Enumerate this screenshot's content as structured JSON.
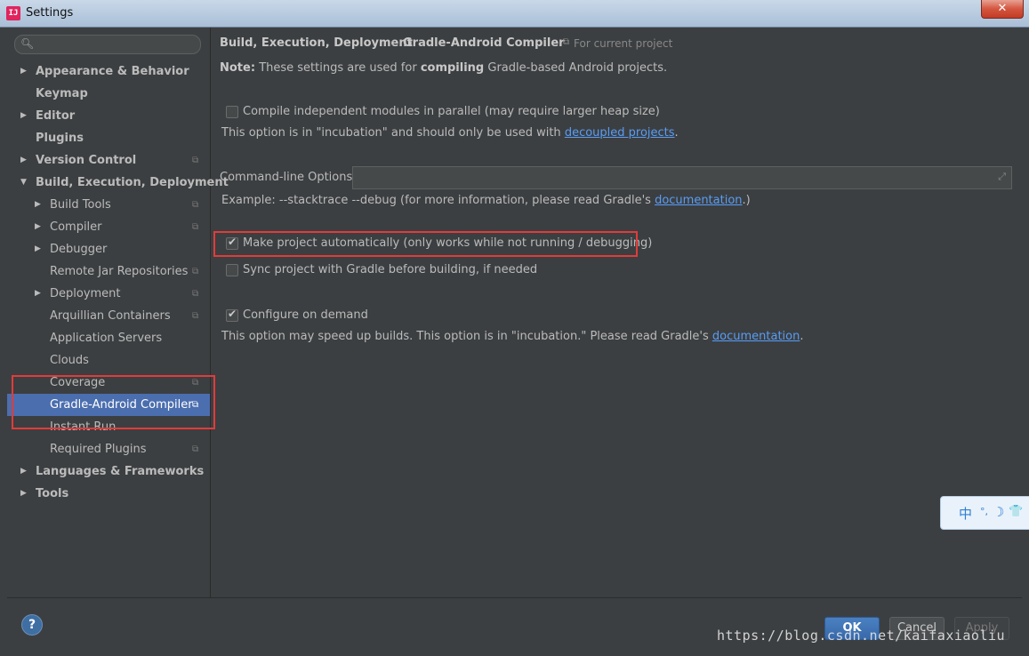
{
  "window": {
    "title": "Settings",
    "app_icon_text": "IJ",
    "close_glyph": "✕"
  },
  "sidebar": {
    "search_placeholder": "",
    "items": [
      {
        "label": "Appearance & Behavior",
        "arrow": "▶",
        "bold": true,
        "level": 0
      },
      {
        "label": "Keymap",
        "arrow": "",
        "bold": true,
        "level": 0
      },
      {
        "label": "Editor",
        "arrow": "▶",
        "bold": true,
        "level": 0
      },
      {
        "label": "Plugins",
        "arrow": "",
        "bold": true,
        "level": 0
      },
      {
        "label": "Version Control",
        "arrow": "▶",
        "bold": true,
        "level": 0,
        "project": true
      },
      {
        "label": "Build, Execution, Deployment",
        "arrow": "▼",
        "bold": true,
        "level": 0
      },
      {
        "label": "Build Tools",
        "arrow": "▶",
        "level": 1,
        "project": true
      },
      {
        "label": "Compiler",
        "arrow": "▶",
        "level": 1,
        "project": true
      },
      {
        "label": "Debugger",
        "arrow": "▶",
        "level": 1
      },
      {
        "label": "Remote Jar Repositories",
        "arrow": "",
        "level": 1,
        "project": true
      },
      {
        "label": "Deployment",
        "arrow": "▶",
        "level": 1,
        "project": true
      },
      {
        "label": "Arquillian Containers",
        "arrow": "",
        "level": 1,
        "project": true
      },
      {
        "label": "Application Servers",
        "arrow": "",
        "level": 1
      },
      {
        "label": "Clouds",
        "arrow": "",
        "level": 1
      },
      {
        "label": "Coverage",
        "arrow": "",
        "level": 1,
        "project": true
      },
      {
        "label": "Gradle-Android Compiler",
        "arrow": "",
        "level": 1,
        "project": true,
        "selected": true
      },
      {
        "label": "Instant Run",
        "arrow": "",
        "level": 1
      },
      {
        "label": "Required Plugins",
        "arrow": "",
        "level": 1,
        "project": true
      },
      {
        "label": "Languages & Frameworks",
        "arrow": "▶",
        "bold": true,
        "level": 0
      },
      {
        "label": "Tools",
        "arrow": "▶",
        "bold": true,
        "level": 0
      }
    ]
  },
  "breadcrumb": {
    "parent": "Build, Execution, Deployment",
    "separator": "›",
    "current": "Gradle-Android Compiler",
    "scope": "For current project"
  },
  "content": {
    "note_label": "Note:",
    "note_text_1": "These settings are used for",
    "note_bold": "compiling",
    "note_text_2": "Gradle-based Android projects.",
    "parallel_label": "Compile independent modules in parallel (may require larger heap size)",
    "parallel_checked": false,
    "incubation_text": "This option is in \"incubation\" and should only be used with",
    "incubation_link": "decoupled projects",
    "incubation_end": ".",
    "cmdline_label": "Command-line Options:",
    "cmdline_value": "",
    "example_text": "Example: --stacktrace --debug (for more information, please read Gradle's",
    "example_link": "documentation",
    "example_end": ".)",
    "make_auto_label": "Make project automatically (only works while not running / debugging)",
    "make_auto_checked": true,
    "sync_label": "Sync project with Gradle before building, if needed",
    "sync_checked": false,
    "configure_label": "Configure on demand",
    "configure_checked": true,
    "configure_desc": "This option may speed up builds. This option is in \"incubation.\" Please read Gradle's",
    "configure_link": "documentation",
    "configure_end": "."
  },
  "footer": {
    "help": "?",
    "ok": "OK",
    "cancel": "Cancel",
    "apply": "Apply"
  },
  "watermark": "https://blog.csdn.net/kaifaxiaoliu",
  "ime": {
    "char": "中",
    "punct": "°,",
    "moon": "☽",
    "shirt": "👕"
  },
  "colors": {
    "accent": "#4b6eaf",
    "link": "#589df6",
    "highlight": "#e23b3b",
    "background": "#3c3f41"
  }
}
